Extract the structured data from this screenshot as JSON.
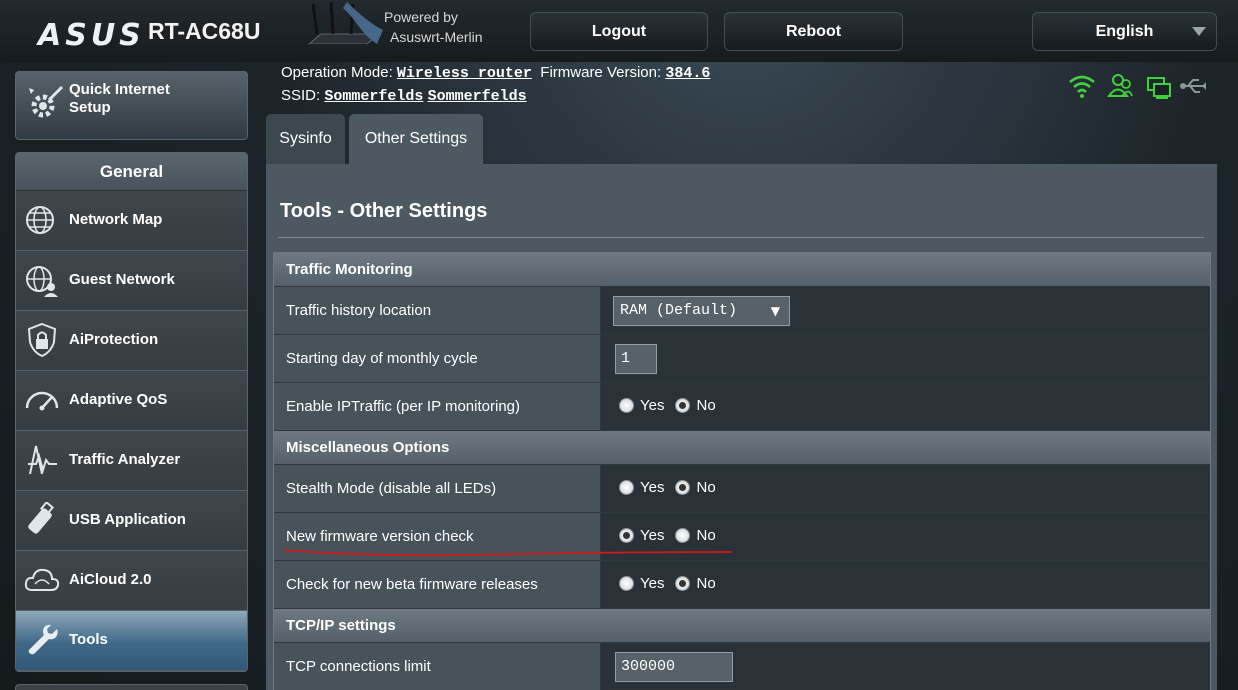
{
  "header": {
    "brand": "ASUS",
    "model": "RT-AC68U",
    "powered_by_line1": "Powered by",
    "powered_by_line2": "Asuswrt-Merlin",
    "logout_label": "Logout",
    "reboot_label": "Reboot",
    "language_label": "English"
  },
  "sidebar": {
    "quick_setup_line1": "Quick Internet",
    "quick_setup_line2": "Setup",
    "general_label": "General",
    "items": [
      {
        "label": "Network Map",
        "icon": "globe-icon"
      },
      {
        "label": "Guest Network",
        "icon": "guest-globe-icon"
      },
      {
        "label": "AiProtection",
        "icon": "shield-lock-icon"
      },
      {
        "label": "Adaptive QoS",
        "icon": "speedometer-icon"
      },
      {
        "label": "Traffic Analyzer",
        "icon": "pulse-icon"
      },
      {
        "label": "USB Application",
        "icon": "usb-icon"
      },
      {
        "label": "AiCloud 2.0",
        "icon": "cloud-icon"
      },
      {
        "label": "Tools",
        "icon": "wrench-icon",
        "active": true
      }
    ]
  },
  "status": {
    "operation_mode_label": "Operation Mode:",
    "operation_mode_value": "Wireless router",
    "firmware_label": "Firmware Version:",
    "firmware_value": "384.6",
    "ssid_label": "SSID:",
    "ssid_1": "Sommerfelds",
    "ssid_2": "Sommerfelds",
    "icons": [
      "wifi-icon",
      "users-icon",
      "devices-icon",
      "usb-status-icon"
    ],
    "status_color": "#3fd13a"
  },
  "tabs": {
    "sysinfo": "Sysinfo",
    "other": "Other Settings"
  },
  "page": {
    "title": "Tools - Other Settings",
    "traffic_monitoring": {
      "heading": "Traffic Monitoring",
      "history_location_label": "Traffic history location",
      "history_location_value": "RAM (Default)",
      "start_day_label": "Starting day of monthly cycle",
      "start_day_value": "1",
      "iptraffic_label": "Enable IPTraffic (per IP monitoring)",
      "iptraffic_value": "No"
    },
    "misc": {
      "heading": "Miscellaneous Options",
      "stealth_label": "Stealth Mode (disable all LEDs)",
      "stealth_value": "No",
      "fw_check_label": "New firmware version check",
      "fw_check_value": "Yes",
      "beta_check_label": "Check for new beta firmware releases",
      "beta_check_value": "No"
    },
    "tcpip": {
      "heading": "TCP/IP settings",
      "conn_limit_label": "TCP connections limit",
      "conn_limit_value": "300000"
    },
    "yes_label": "Yes",
    "no_label": "No"
  },
  "colors": {
    "annotation_line": "#d11a1a",
    "active_menu": "#3f6888"
  }
}
